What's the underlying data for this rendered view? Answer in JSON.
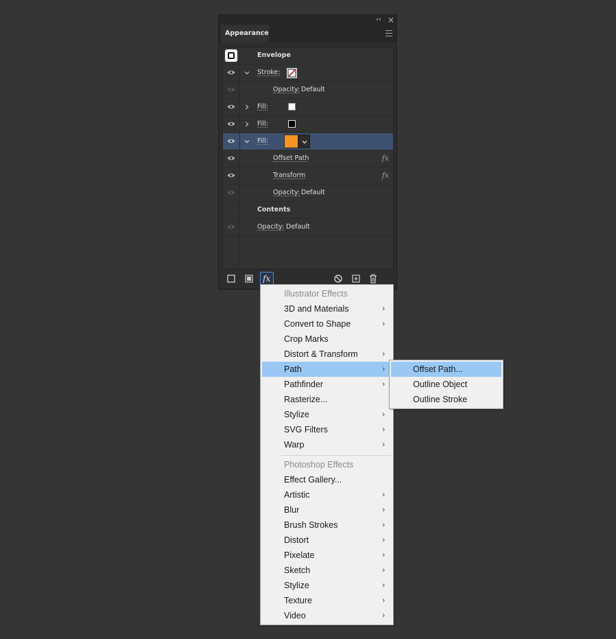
{
  "panel": {
    "title": "Appearance",
    "collapse_glyph": "‹‹",
    "close_glyph": "×",
    "menu_icon": "hamburger-icon",
    "rows": [
      {
        "kind": "envelope",
        "label": "Envelope"
      },
      {
        "kind": "stroke",
        "label": "Stroke:",
        "swatch": "none-red-slash"
      },
      {
        "kind": "opacity",
        "label": "Opacity:",
        "value": "Default"
      },
      {
        "kind": "fill",
        "label": "Fill:",
        "swatch_color": "#ffffff"
      },
      {
        "kind": "fill",
        "label": "Fill:",
        "swatch_color": "#000000"
      },
      {
        "kind": "fill-selected",
        "label": "Fill:",
        "swatch_color": "#f7931e"
      },
      {
        "kind": "effect",
        "label": "Offset Path",
        "fx": "fx"
      },
      {
        "kind": "effect",
        "label": "Transform",
        "fx": "fx"
      },
      {
        "kind": "opacity",
        "label": "Opacity:",
        "value": "Default"
      },
      {
        "kind": "contents",
        "label": "Contents"
      },
      {
        "kind": "opacity",
        "label": "Opacity:",
        "value": "Default"
      }
    ],
    "bottom_buttons": [
      "add-new-stroke",
      "add-new-fill",
      "add-new-effect",
      "clear-appearance",
      "duplicate-item",
      "delete-item"
    ],
    "fx_label": "fx"
  },
  "effects_menu": {
    "sections": [
      {
        "header": "Illustrator Effects",
        "items": [
          {
            "label": "3D and Materials",
            "submenu": true
          },
          {
            "label": "Convert to Shape",
            "submenu": true
          },
          {
            "label": "Crop Marks",
            "submenu": false
          },
          {
            "label": "Distort & Transform",
            "submenu": true
          },
          {
            "label": "Path",
            "submenu": true,
            "highlighted": true
          },
          {
            "label": "Pathfinder",
            "submenu": true
          },
          {
            "label": "Rasterize...",
            "submenu": false
          },
          {
            "label": "Stylize",
            "submenu": true
          },
          {
            "label": "SVG Filters",
            "submenu": true
          },
          {
            "label": "Warp",
            "submenu": true
          }
        ]
      },
      {
        "header": "Photoshop Effects",
        "items": [
          {
            "label": "Effect Gallery...",
            "submenu": false
          },
          {
            "label": "Artistic",
            "submenu": true
          },
          {
            "label": "Blur",
            "submenu": true
          },
          {
            "label": "Brush Strokes",
            "submenu": true
          },
          {
            "label": "Distort",
            "submenu": true
          },
          {
            "label": "Pixelate",
            "submenu": true
          },
          {
            "label": "Sketch",
            "submenu": true
          },
          {
            "label": "Stylize",
            "submenu": true
          },
          {
            "label": "Texture",
            "submenu": true
          },
          {
            "label": "Video",
            "submenu": true
          }
        ]
      }
    ],
    "arrow_glyph": "›"
  },
  "path_submenu": {
    "items": [
      {
        "label": "Offset Path...",
        "highlighted": true
      },
      {
        "label": "Outline Object"
      },
      {
        "label": "Outline Stroke"
      }
    ]
  },
  "colors": {
    "selection": "#3f5170",
    "menu_highlight": "#99c8f5",
    "fill_orange": "#f7931e"
  }
}
